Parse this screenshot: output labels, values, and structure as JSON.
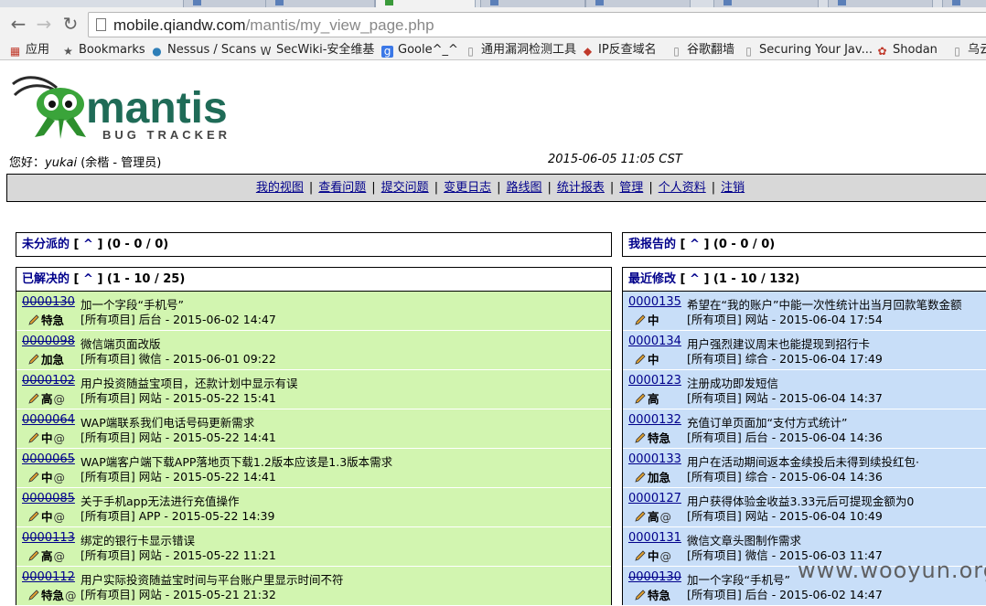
{
  "browser": {
    "url_host": "mobile.qiandw.com",
    "url_path": "/mantis/my_view_page.php",
    "bookmarks": [
      {
        "label": "应用",
        "icon": "apps-grid-icon"
      },
      {
        "label": "Bookmarks",
        "icon": "star-icon"
      },
      {
        "label": "Nessus / Scans",
        "icon": "nessus-icon"
      },
      {
        "label": "SecWiki-安全维基",
        "icon": "wiki-icon"
      },
      {
        "label": "Goole^_^",
        "icon": "google-icon"
      },
      {
        "label": "通用漏洞检测工具",
        "icon": "page-icon"
      },
      {
        "label": "IP反查域名",
        "icon": "ip-icon"
      },
      {
        "label": "谷歌翻墙",
        "icon": "page-icon"
      },
      {
        "label": "Securing Your Jav...",
        "icon": "page-icon"
      },
      {
        "label": "Shodan",
        "icon": "shodan-icon"
      },
      {
        "label": "乌云",
        "icon": "page-icon"
      }
    ]
  },
  "header": {
    "logo_text": "mantis",
    "logo_sub": "BUG TRACKER",
    "greeting_prefix": "您好：",
    "user": "yukai",
    "user_role": "(余楷 - 管理员)",
    "datetime": "2015-06-05 11:05 CST"
  },
  "menu": [
    "我的视图",
    "查看问题",
    "提交问题",
    "变更日志",
    "路线图",
    "统计报表",
    "管理",
    "个人资料",
    "注销"
  ],
  "panels": {
    "unassigned": {
      "title": "未分派的",
      "caret": "^",
      "count": "(0 - 0 / 0)"
    },
    "reported": {
      "title": "我报告的",
      "caret": "^",
      "count": "(0 - 0 / 0)"
    },
    "resolved": {
      "title": "已解决的",
      "caret": "^",
      "count": "(1 - 10 / 25)",
      "rows": [
        {
          "id": "0000130",
          "summary": "加一个字段“手机号”",
          "project": "[所有项目] 后台 - 2015-06-02 14:47",
          "priority": "特急",
          "attach": ""
        },
        {
          "id": "0000098",
          "summary": "微信端页面改版",
          "project": "[所有项目] 微信 - 2015-06-01 09:22",
          "priority": "加急",
          "attach": ""
        },
        {
          "id": "0000102",
          "summary": "用户投资随益宝项目，还款计划中显示有误",
          "project": "[所有项目] 网站 - 2015-05-22 15:41",
          "priority": "高",
          "attach": "@"
        },
        {
          "id": "0000064",
          "summary": "WAP端联系我们电话号码更新需求",
          "project": "[所有项目] 网站 - 2015-05-22 14:41",
          "priority": "中",
          "attach": "@"
        },
        {
          "id": "0000065",
          "summary": "WAP端客户端下载APP落地页下载1.2版本应该是1.3版本需求",
          "project": "[所有项目] 网站 - 2015-05-22 14:41",
          "priority": "中",
          "attach": "@"
        },
        {
          "id": "0000085",
          "summary": "关于手机app无法进行充值操作",
          "project": "[所有项目] APP - 2015-05-22 14:39",
          "priority": "中",
          "attach": "@"
        },
        {
          "id": "0000113",
          "summary": "绑定的银行卡显示错误",
          "project": "[所有项目] 网站 - 2015-05-22 11:21",
          "priority": "高",
          "attach": "@"
        },
        {
          "id": "0000112",
          "summary": "用户实际投资随益宝时间与平台账户里显示时间不符",
          "project": "[所有项目] 网站 - 2015-05-21 21:32",
          "priority": "特急",
          "attach": "@"
        }
      ]
    },
    "recent": {
      "title": "最近修改",
      "caret": "^",
      "count": "(1 - 10 / 132)",
      "rows": [
        {
          "id": "0000135",
          "summary": "希望在“我的账户”中能一次性统计出当月回款笔数金额",
          "project": "[所有项目] 网站 - 2015-06-04 17:54",
          "priority": "中",
          "attach": "",
          "strike": false
        },
        {
          "id": "0000134",
          "summary": "用户强烈建议周末也能提现到招行卡",
          "project": "[所有项目] 综合 - 2015-06-04 17:49",
          "priority": "中",
          "attach": "",
          "strike": false
        },
        {
          "id": "0000123",
          "summary": "注册成功即发短信",
          "project": "[所有项目] 网站 - 2015-06-04 14:37",
          "priority": "高",
          "attach": "",
          "strike": false
        },
        {
          "id": "0000132",
          "summary": "充值订单页面加“支付方式统计”",
          "project": "[所有项目] 后台 - 2015-06-04 14:36",
          "priority": "特急",
          "attach": "",
          "strike": false
        },
        {
          "id": "0000133",
          "summary": "用户在活动期间返本金续投后未得到续投红包·",
          "project": "[所有项目] 综合 - 2015-06-04 14:36",
          "priority": "加急",
          "attach": "",
          "strike": false
        },
        {
          "id": "0000127",
          "summary": "用户获得体验金收益3.33元后可提现金额为0",
          "project": "[所有项目] 网站 - 2015-06-04 10:49",
          "priority": "高",
          "attach": "@",
          "strike": false
        },
        {
          "id": "0000131",
          "summary": "微信文章头图制作需求",
          "project": "[所有项目] 微信 - 2015-06-03 11:47",
          "priority": "中",
          "attach": "@",
          "strike": false
        },
        {
          "id": "0000130",
          "summary": "加一个字段“手机号”",
          "project": "[所有项目] 后台 - 2015-06-02 14:47",
          "priority": "特急",
          "attach": "",
          "strike": true
        }
      ]
    }
  },
  "watermark": "www.wooyun.org"
}
